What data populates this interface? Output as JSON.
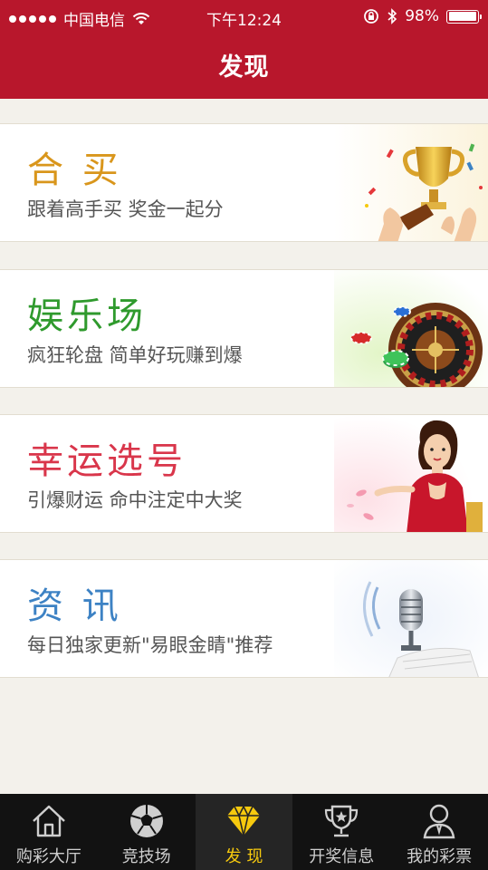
{
  "status_bar": {
    "carrier": "中国电信",
    "time": "下午12:24",
    "battery_text": "98%",
    "battery_level": 0.98
  },
  "header": {
    "title": "发现"
  },
  "cards": [
    {
      "title": "合 买",
      "subtitle": "跟着高手买 奖金一起分",
      "color": "#d9961c",
      "art": "trophy-icon"
    },
    {
      "title": "娱乐场",
      "subtitle": "疯狂轮盘 简单好玩赚到爆",
      "color": "#2f9a2d",
      "art": "roulette-icon"
    },
    {
      "title": "幸运选号",
      "subtitle": "引爆财运 命中注定中大奖",
      "color": "#d9364b",
      "art": "lucky-lady-icon"
    },
    {
      "title": "资 讯",
      "subtitle": "每日独家更新\"易眼金睛\"推荐",
      "color": "#3d82c4",
      "art": "microphone-icon"
    }
  ],
  "tabs": [
    {
      "label": "购彩大厅",
      "icon": "home-icon",
      "active": false
    },
    {
      "label": "竞技场",
      "icon": "soccer-ball-icon",
      "active": false
    },
    {
      "label": "发 现",
      "icon": "diamond-icon",
      "active": true
    },
    {
      "label": "开奖信息",
      "icon": "trophy-cup-icon",
      "active": false
    },
    {
      "label": "我的彩票",
      "icon": "user-icon",
      "active": false
    }
  ],
  "colors": {
    "header_red": "#b8172c",
    "tab_active": "#f6c90e",
    "background": "#f3f1eb"
  }
}
